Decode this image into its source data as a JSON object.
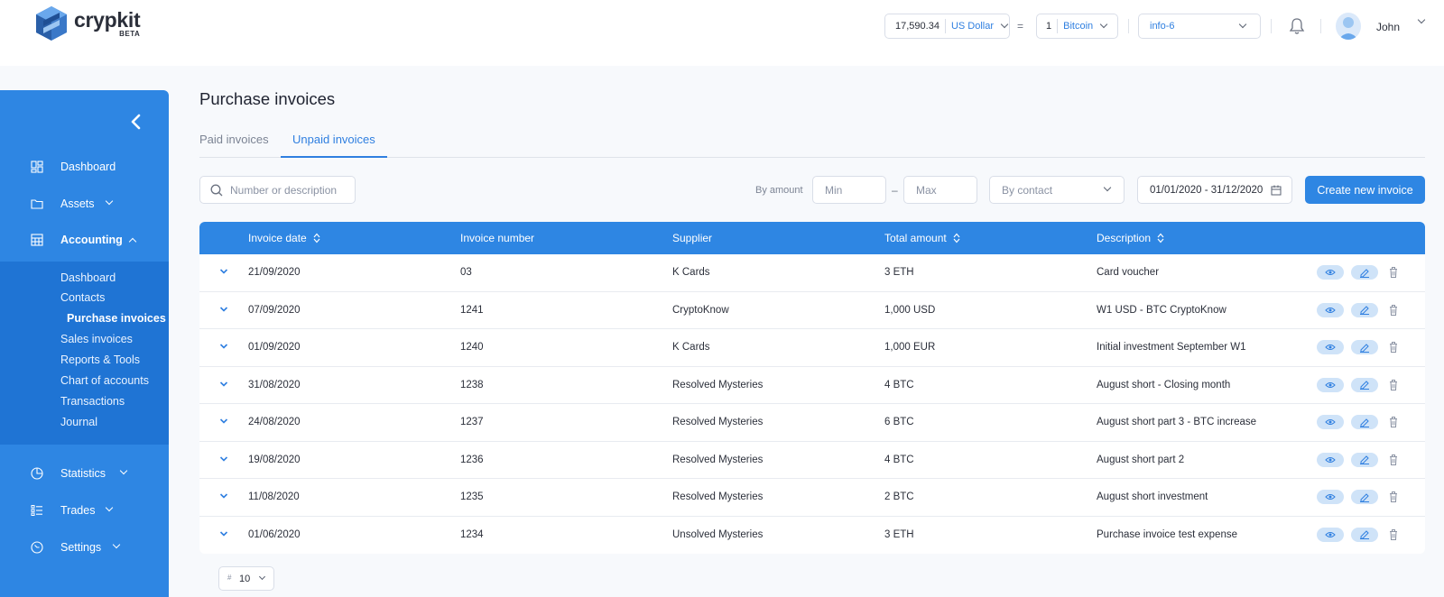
{
  "brand": {
    "name": "crypkit",
    "badge": "BETA"
  },
  "header": {
    "fiat_amount": "17,590.34",
    "fiat_currency": "US Dollar",
    "equals": "=",
    "crypto_amount": "1",
    "crypto_currency": "Bitcoin",
    "workspace": "info-6",
    "user_name": "John"
  },
  "sidebar": {
    "items": [
      {
        "label": "Dashboard",
        "icon": "grid-icon"
      },
      {
        "label": "Assets",
        "icon": "folder-icon"
      },
      {
        "label": "Accounting",
        "icon": "calculator-icon"
      },
      {
        "label": "Statistics",
        "icon": "pie-chart-icon"
      },
      {
        "label": "Trades",
        "icon": "list-icon"
      },
      {
        "label": "Settings",
        "icon": "settings-icon"
      }
    ],
    "accounting_sub": [
      "Dashboard",
      "Contacts",
      "Purchase invoices",
      "Sales invoices",
      "Reports & Tools",
      "Chart of accounts",
      "Transactions",
      "Journal"
    ],
    "active_sub": "Purchase invoices"
  },
  "page": {
    "title": "Purchase invoices",
    "tabs": [
      "Paid invoices",
      "Unpaid invoices"
    ],
    "active_tab": "Unpaid invoices"
  },
  "filters": {
    "search_placeholder": "Number or description",
    "by_amount_label": "By amount",
    "min_placeholder": "Min",
    "dash": "–",
    "max_placeholder": "Max",
    "contact_placeholder": "By contact",
    "date_range": "01/01/2020 - 31/12/2020",
    "create_button": "Create new invoice"
  },
  "table": {
    "columns": [
      "Invoice date",
      "Invoice number",
      "Supplier",
      "Total amount",
      "Description"
    ],
    "rows": [
      {
        "date": "21/09/2020",
        "number": "03",
        "supplier": "K Cards",
        "amount": "3 ETH",
        "description": "Card voucher"
      },
      {
        "date": "07/09/2020",
        "number": "1241",
        "supplier": "CryptoKnow",
        "amount": "1,000 USD",
        "description": "W1 USD - BTC CryptoKnow"
      },
      {
        "date": "01/09/2020",
        "number": "1240",
        "supplier": "K Cards",
        "amount": "1,000 EUR",
        "description": "Initial investment September W1"
      },
      {
        "date": "31/08/2020",
        "number": "1238",
        "supplier": "Resolved Mysteries",
        "amount": "4 BTC",
        "description": "August short - Closing month"
      },
      {
        "date": "24/08/2020",
        "number": "1237",
        "supplier": "Resolved Mysteries",
        "amount": "6 BTC",
        "description": "August short part 3 - BTC increase"
      },
      {
        "date": "19/08/2020",
        "number": "1236",
        "supplier": "Resolved Mysteries",
        "amount": "4 BTC",
        "description": "August short part 2"
      },
      {
        "date": "11/08/2020",
        "number": "1235",
        "supplier": "Resolved Mysteries",
        "amount": "2 BTC",
        "description": "August short investment"
      },
      {
        "date": "01/06/2020",
        "number": "1234",
        "supplier": "Unsolved Mysteries",
        "amount": "3 ETH",
        "description": "Purchase invoice test expense"
      }
    ]
  },
  "pagination": {
    "page_size_prefix": "#",
    "page_size": "10"
  },
  "colors": {
    "primary": "#2e86e3",
    "primary_dark": "#1f74d4",
    "accent_text": "#2f7fe0",
    "action_pill": "#cfe3f8"
  }
}
